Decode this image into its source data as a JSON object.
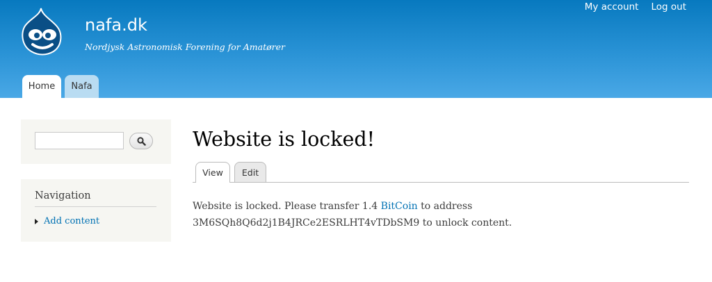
{
  "site": {
    "name": "nafa.dk",
    "slogan": "Nordjysk Astronomisk Forening for Amatører"
  },
  "secondary_menu": {
    "my_account": "My account",
    "log_out": "Log out"
  },
  "primary_menu": {
    "home": "Home",
    "nafa": "Nafa"
  },
  "search": {
    "value": "",
    "placeholder": ""
  },
  "navigation": {
    "title": "Navigation",
    "items": [
      "Add content"
    ]
  },
  "page": {
    "title": "Website is locked!",
    "tabs": {
      "view": "View",
      "edit": "Edit"
    },
    "body_before_link": "Website is locked. Please transfer 1.4 ",
    "link_text": "BitCoin",
    "body_after_link": " to address 3M6SQh8Q6d2j1B4JRCe2ESRLHT4vTDbSM9 to unlock content."
  },
  "colors": {
    "header_top": "#0779bf",
    "header_bottom": "#4aa8e6",
    "link": "#0071b3",
    "sidebar_bg": "#f6f6f2"
  },
  "icons": {
    "logo": "drupal-drop-logo",
    "search": "magnifier-icon",
    "bullet": "triangle-right-icon"
  }
}
